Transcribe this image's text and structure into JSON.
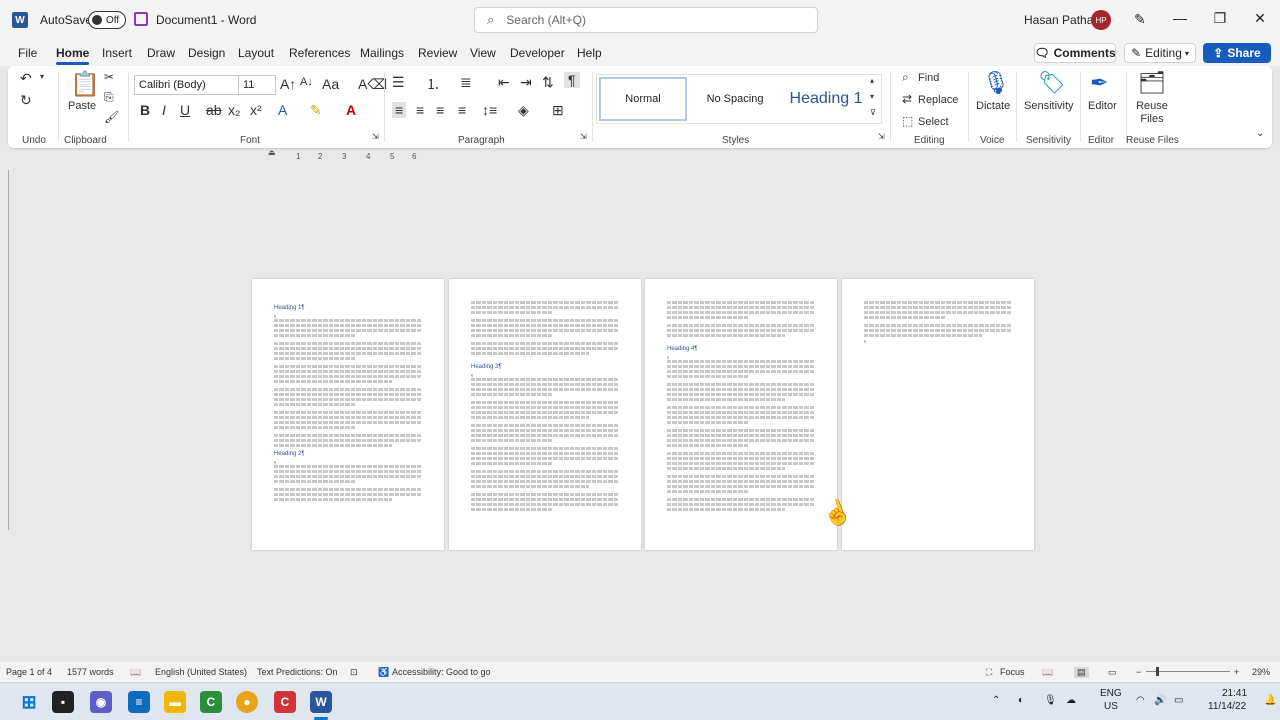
{
  "titlebar": {
    "autosave_label": "AutoSave",
    "autosave_state": "Off",
    "doc_title": "Document1  -  Word",
    "search_placeholder": "Search (Alt+Q)",
    "user_name": "Hasan Pathan",
    "user_initials": "HP"
  },
  "menu": {
    "tabs": [
      "File",
      "Home",
      "Insert",
      "Draw",
      "Design",
      "Layout",
      "References",
      "Mailings",
      "Review",
      "View",
      "Developer",
      "Help"
    ],
    "active": "Home",
    "comments": "Comments",
    "editing": "Editing",
    "share": "Share"
  },
  "ribbon": {
    "undo_label": "Undo",
    "paste_label": "Paste",
    "clipboard_label": "Clipboard",
    "font_name": "Calibri (Body)",
    "font_size": "11",
    "font_label": "Font",
    "paragraph_label": "Paragraph",
    "styles_label": "Styles",
    "styles": [
      "Normal",
      "No Spacing",
      "Heading 1"
    ],
    "find": "Find",
    "replace": "Replace",
    "select": "Select",
    "editing_label": "Editing",
    "dictate": "Dictate",
    "voice_label": "Voice",
    "sensitivity": "Sensitivity",
    "sensitivity_label": "Sensitivity",
    "editor": "Editor",
    "editor_label": "Editor",
    "reuse_files": "Reuse Files",
    "reuse_files_label": "Reuse Files"
  },
  "ruler_marks": [
    "1",
    "2",
    "3",
    "4",
    "5",
    "6"
  ],
  "pages": {
    "p1_heading_a": "Heading 1¶",
    "p1_heading_b": "Heading 2¶",
    "p2_heading": "Heading 3¶",
    "p3_heading": "Heading 4¶"
  },
  "status": {
    "page": "Page 1 of 4",
    "words": "1577 words",
    "language": "English (United States)",
    "predictions": "Text Predictions: On",
    "accessibility": "Accessibility: Good to go",
    "focus": "Focus",
    "zoom": "29%"
  },
  "taskbar": {
    "lang": "ENG",
    "region": "US",
    "time": "21:41",
    "date": "11/14/22"
  }
}
